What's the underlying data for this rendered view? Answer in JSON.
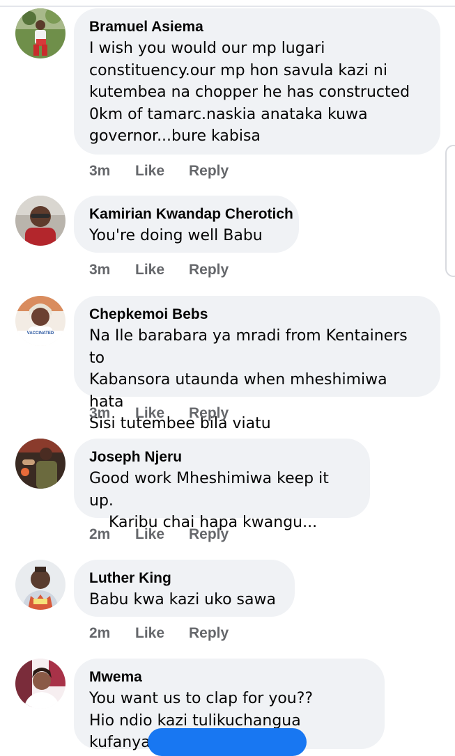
{
  "comments": [
    {
      "author": "Bramuel Asiema",
      "text": "I wish you would our mp lugari\nconstituency.our mp hon savula kazi ni\nkutembea na chopper he has constructed\n0km of tamarc.naskia anataka kuwa\ngovernor...bure kabisa",
      "time": "3m",
      "like": "Like",
      "reply": "Reply"
    },
    {
      "author": "Kamirian Kwandap Cherotich",
      "text": "You're doing well Babu",
      "time": "3m",
      "like": "Like",
      "reply": "Reply"
    },
    {
      "author": "Chepkemoi Bebs",
      "text": "Na Ile barabara ya mradi from Kentainers to\nKabansora utaunda when mheshimiwa hata\nSisi tutembee bila viatu",
      "time": "3m",
      "like": "Like",
      "reply": "Reply",
      "avatar_badge": "VACCINATED"
    },
    {
      "author": "Joseph Njeru",
      "text": "Good work Mheshimiwa keep it up.\n    Karibu chai hapa kwangu...",
      "time": "2m",
      "like": "Like",
      "reply": "Reply"
    },
    {
      "author": "Luther King",
      "text": "Babu kwa kazi uko sawa",
      "time": "2m",
      "like": "Like",
      "reply": "Reply"
    },
    {
      "author": "Mwema",
      "text": "You want us to clap for you??\nHio ndio kazi tulikuchangua kufanya.",
      "time": "",
      "like": "",
      "reply": ""
    }
  ],
  "colors": {
    "bubble": "#f0f2f5",
    "author": "#050505",
    "meta": "#65676b",
    "accent": "#1877f2"
  }
}
